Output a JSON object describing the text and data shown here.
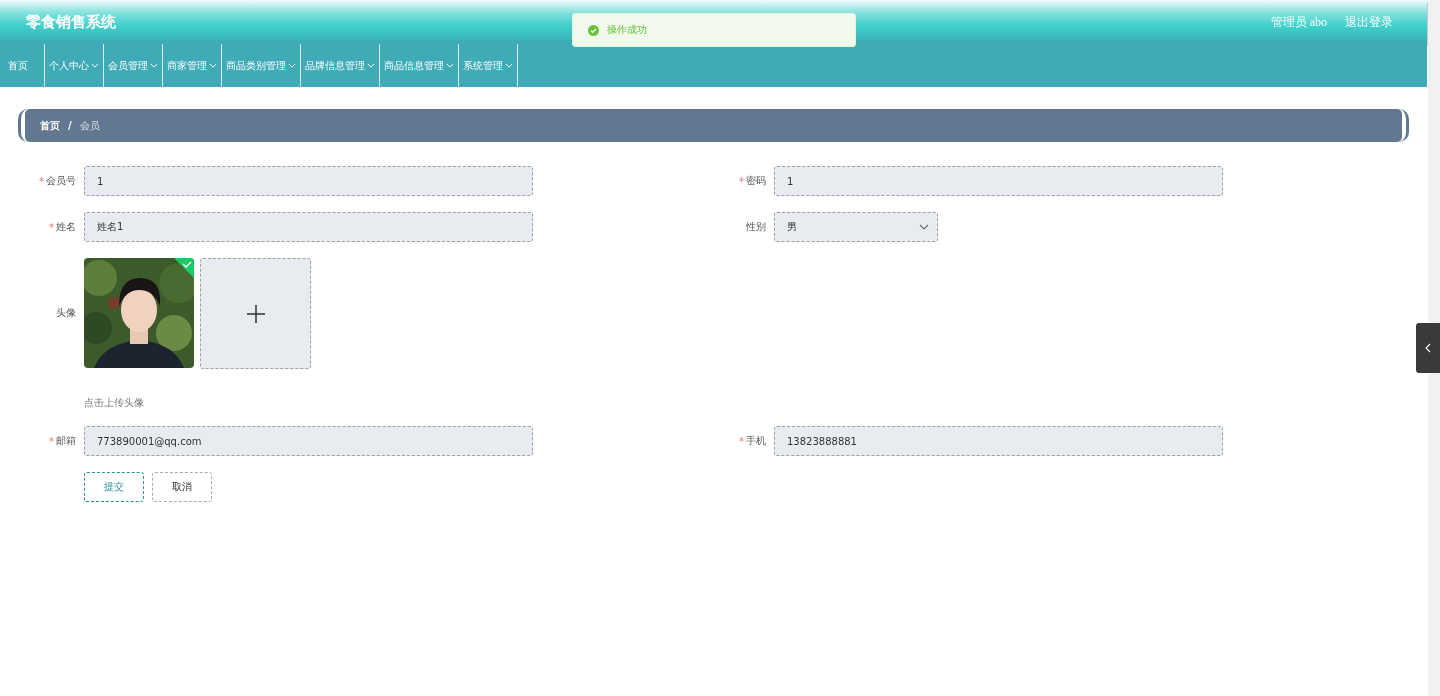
{
  "header": {
    "title": "零食销售系统",
    "user": "管理员 abo",
    "logout": "退出登录"
  },
  "toast": {
    "message": "操作成功"
  },
  "nav": [
    {
      "label": "首页",
      "has_dropdown": false
    },
    {
      "label": "个人中心",
      "has_dropdown": true
    },
    {
      "label": "会员管理",
      "has_dropdown": true
    },
    {
      "label": "商家管理",
      "has_dropdown": true
    },
    {
      "label": "商品类别管理",
      "has_dropdown": true
    },
    {
      "label": "品牌信息管理",
      "has_dropdown": true
    },
    {
      "label": "商品信息管理",
      "has_dropdown": true
    },
    {
      "label": "系统管理",
      "has_dropdown": true
    }
  ],
  "breadcrumb": {
    "items": [
      "首页",
      "会员"
    ],
    "separator": "/"
  },
  "form": {
    "required_mark": "*",
    "rows": [
      [
        {
          "kind": "text",
          "label": "会员号",
          "required": true,
          "value": "1"
        },
        {
          "kind": "text",
          "label": "密码",
          "required": true,
          "value": "1"
        }
      ],
      [
        {
          "kind": "text",
          "label": "姓名",
          "required": true,
          "value": "姓名1"
        },
        {
          "kind": "select",
          "label": "性别",
          "required": false,
          "value": "男"
        }
      ],
      [
        {
          "kind": "upload",
          "label": "头像",
          "required": false,
          "uploaded": true,
          "hint": "点击上传头像"
        }
      ],
      [
        {
          "kind": "text",
          "label": "邮箱",
          "required": true,
          "value": "773890001@qq.com"
        },
        {
          "kind": "text",
          "label": "手机",
          "required": true,
          "value": "13823888881"
        }
      ]
    ],
    "buttons": [
      {
        "label": "提交",
        "kind": "primary"
      },
      {
        "label": "取消",
        "kind": "default"
      }
    ]
  }
}
